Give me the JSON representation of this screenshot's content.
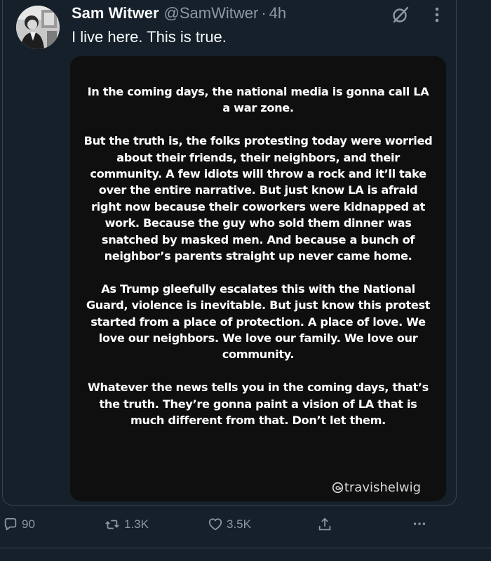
{
  "post": {
    "display_name": "Sam Witwer",
    "handle": "@SamWitwer",
    "separator": "·",
    "time": "4h",
    "text": "I live here. This is true.",
    "avatar_icon": "avatar-photo",
    "grok_icon": "grok-icon",
    "more_icon": "more-icon"
  },
  "media": {
    "paragraphs": [
      "In the coming days, the national media is gonna call LA a war zone.",
      "But the truth is, the folks protesting today were worried about their friends, their neighbors, and their community. A few idiots will throw a rock and it’ll take over the entire narrative. But just know LA is afraid right now because their coworkers were kidnapped at work. Because the guy who sold them dinner was snatched by masked men. And because a bunch of neighbor’s parents straight up never came home.",
      "As Trump gleefully escalates this with the National Guard, violence is inevitable. But just know this protest started from a place of protection. A place of love. We love our neighbors. We love our family. We love our community.",
      "Whatever the news tells you in the coming days, that’s the truth. They’re gonna paint a vision of LA that is much different from that. Don’t let them."
    ],
    "watermark": "travishelwig",
    "watermark_icon": "threads-icon"
  },
  "actions": {
    "replies": "90",
    "reposts": "1.3K",
    "likes": "3.5K",
    "share_icon": "share-icon",
    "more_icon": "more-horizontal-icon"
  },
  "colors": {
    "background": "#15202b",
    "text_primary": "#f7f9f9",
    "text_secondary": "#8b98a5",
    "border": "#38444d",
    "media_background": "#0f0f0f"
  }
}
